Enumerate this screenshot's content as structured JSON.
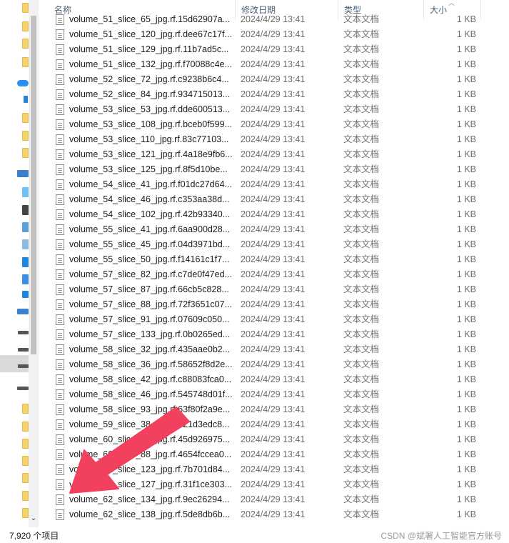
{
  "header": {
    "name": "名称",
    "date_modified": "修改日期",
    "type": "类型",
    "size": "大小",
    "sort_indicator": "^"
  },
  "files": [
    {
      "name": "volume_51_slice_65_jpg.rf.15d62907a...",
      "date": "2024/4/29 13:41",
      "type": "文本文档",
      "size": "1 KB"
    },
    {
      "name": "volume_51_slice_120_jpg.rf.dee67c17f...",
      "date": "2024/4/29 13:41",
      "type": "文本文档",
      "size": "1 KB"
    },
    {
      "name": "volume_51_slice_129_jpg.rf.11b7ad5c...",
      "date": "2024/4/29 13:41",
      "type": "文本文档",
      "size": "1 KB"
    },
    {
      "name": "volume_51_slice_132_jpg.rf.f70088c4e...",
      "date": "2024/4/29 13:41",
      "type": "文本文档",
      "size": "1 KB"
    },
    {
      "name": "volume_52_slice_72_jpg.rf.c9238b6c4...",
      "date": "2024/4/29 13:41",
      "type": "文本文档",
      "size": "1 KB"
    },
    {
      "name": "volume_52_slice_84_jpg.rf.934715013...",
      "date": "2024/4/29 13:41",
      "type": "文本文档",
      "size": "1 KB"
    },
    {
      "name": "volume_53_slice_53_jpg.rf.dde600513...",
      "date": "2024/4/29 13:41",
      "type": "文本文档",
      "size": "1 KB"
    },
    {
      "name": "volume_53_slice_108_jpg.rf.bceb0f599...",
      "date": "2024/4/29 13:41",
      "type": "文本文档",
      "size": "1 KB"
    },
    {
      "name": "volume_53_slice_110_jpg.rf.83c77103...",
      "date": "2024/4/29 13:41",
      "type": "文本文档",
      "size": "1 KB"
    },
    {
      "name": "volume_53_slice_121_jpg.rf.4a18e9fb6...",
      "date": "2024/4/29 13:41",
      "type": "文本文档",
      "size": "1 KB"
    },
    {
      "name": "volume_53_slice_125_jpg.rf.8f5d10be...",
      "date": "2024/4/29 13:41",
      "type": "文本文档",
      "size": "1 KB"
    },
    {
      "name": "volume_54_slice_41_jpg.rf.f01dc27d64...",
      "date": "2024/4/29 13:41",
      "type": "文本文档",
      "size": "1 KB"
    },
    {
      "name": "volume_54_slice_46_jpg.rf.c353aa38d...",
      "date": "2024/4/29 13:41",
      "type": "文本文档",
      "size": "1 KB"
    },
    {
      "name": "volume_54_slice_102_jpg.rf.42b93340...",
      "date": "2024/4/29 13:41",
      "type": "文本文档",
      "size": "1 KB"
    },
    {
      "name": "volume_55_slice_41_jpg.rf.6aa900d28...",
      "date": "2024/4/29 13:41",
      "type": "文本文档",
      "size": "1 KB"
    },
    {
      "name": "volume_55_slice_45_jpg.rf.04d3971bd...",
      "date": "2024/4/29 13:41",
      "type": "文本文档",
      "size": "1 KB"
    },
    {
      "name": "volume_55_slice_50_jpg.rf.f14161c1f7...",
      "date": "2024/4/29 13:41",
      "type": "文本文档",
      "size": "1 KB"
    },
    {
      "name": "volume_57_slice_82_jpg.rf.c7de0f47ed...",
      "date": "2024/4/29 13:41",
      "type": "文本文档",
      "size": "1 KB"
    },
    {
      "name": "volume_57_slice_87_jpg.rf.66cb5c828...",
      "date": "2024/4/29 13:41",
      "type": "文本文档",
      "size": "1 KB"
    },
    {
      "name": "volume_57_slice_88_jpg.rf.72f3651c07...",
      "date": "2024/4/29 13:41",
      "type": "文本文档",
      "size": "1 KB"
    },
    {
      "name": "volume_57_slice_91_jpg.rf.07609c050...",
      "date": "2024/4/29 13:41",
      "type": "文本文档",
      "size": "1 KB"
    },
    {
      "name": "volume_57_slice_133_jpg.rf.0b0265ed...",
      "date": "2024/4/29 13:41",
      "type": "文本文档",
      "size": "1 KB"
    },
    {
      "name": "volume_58_slice_32_jpg.rf.435aae0b2...",
      "date": "2024/4/29 13:41",
      "type": "文本文档",
      "size": "1 KB"
    },
    {
      "name": "volume_58_slice_36_jpg.rf.58652f8d2e...",
      "date": "2024/4/29 13:41",
      "type": "文本文档",
      "size": "1 KB"
    },
    {
      "name": "volume_58_slice_42_jpg.rf.c88083fca0...",
      "date": "2024/4/29 13:41",
      "type": "文本文档",
      "size": "1 KB"
    },
    {
      "name": "volume_58_slice_46_jpg.rf.545748d01f...",
      "date": "2024/4/29 13:41",
      "type": "文本文档",
      "size": "1 KB"
    },
    {
      "name": "volume_58_slice_93_jpg.rf.63f80f2a9e...",
      "date": "2024/4/29 13:41",
      "type": "文本文档",
      "size": "1 KB"
    },
    {
      "name": "volume_59_slice_38_jpg.rf.d21d3edc8...",
      "date": "2024/4/29 13:41",
      "type": "文本文档",
      "size": "1 KB"
    },
    {
      "name": "volume_60_slice_37_jpg.rf.45d926975...",
      "date": "2024/4/29 13:41",
      "type": "文本文档",
      "size": "1 KB"
    },
    {
      "name": "volume_60_slice_88_jpg.rf.4654fccea0...",
      "date": "2024/4/29 13:41",
      "type": "文本文档",
      "size": "1 KB"
    },
    {
      "name": "volume_62_slice_123_jpg.rf.7b701d84...",
      "date": "2024/4/29 13:41",
      "type": "文本文档",
      "size": "1 KB"
    },
    {
      "name": "volume_62_slice_127_jpg.rf.31f1ce303...",
      "date": "2024/4/29 13:41",
      "type": "文本文档",
      "size": "1 KB"
    },
    {
      "name": "volume_62_slice_134_jpg.rf.9ec26294...",
      "date": "2024/4/29 13:41",
      "type": "文本文档",
      "size": "1 KB"
    },
    {
      "name": "volume_62_slice_138_jpg.rf.5de8db6b...",
      "date": "2024/4/29 13:41",
      "type": "文本文档",
      "size": "1 KB"
    }
  ],
  "status": {
    "item_count": "7,920 个项目",
    "watermark": "CSDN @斌署人工智能官方账号"
  },
  "icons": {
    "file": "text-file-icon",
    "folder": "folder-icon",
    "annotation": "red-arrow-icon"
  },
  "colors": {
    "annotation": "#f2405f",
    "header_text": "#4c607a",
    "folder": "#f5d36b"
  }
}
